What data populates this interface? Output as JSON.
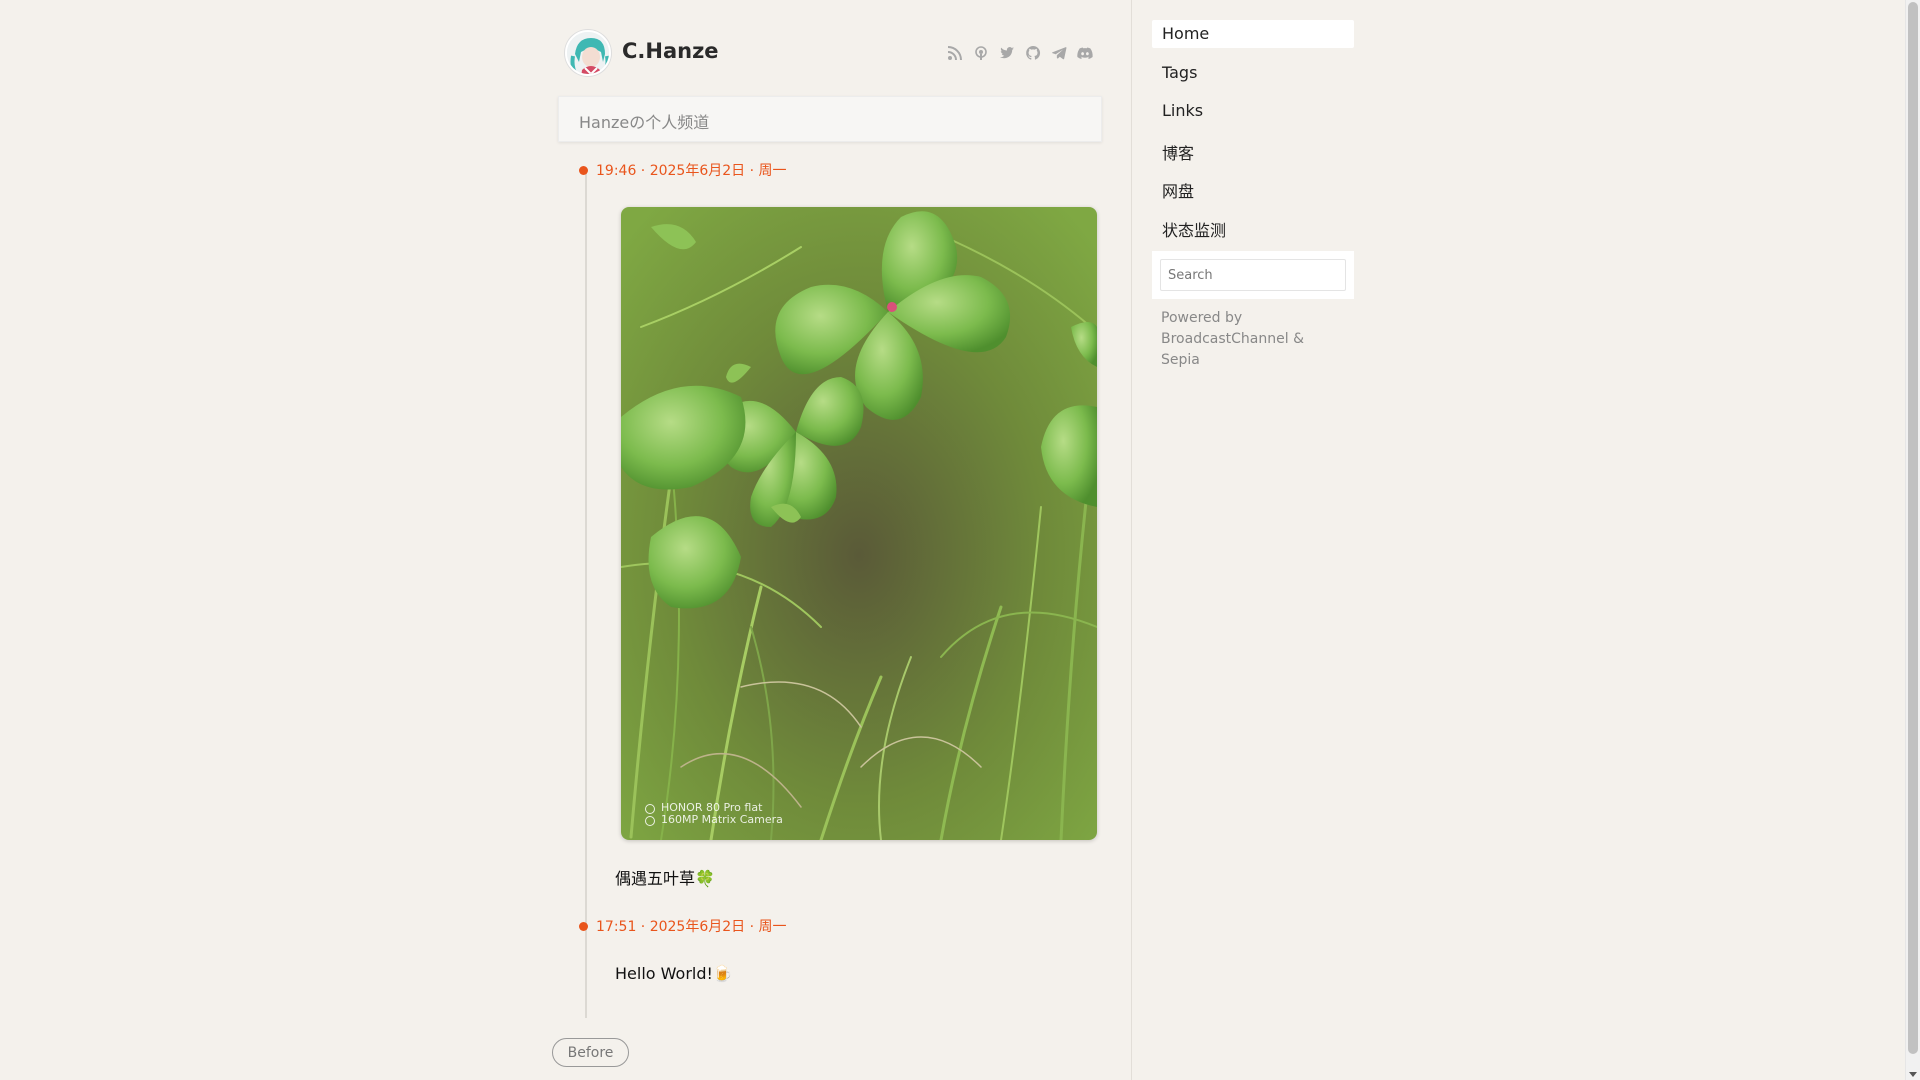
{
  "header": {
    "site_title": "C.Hanze",
    "avatar_alt": "C.Hanze avatar",
    "social_icons": [
      "rss-icon",
      "podcast-icon",
      "twitter-icon",
      "github-icon",
      "telegram-icon",
      "discord-icon"
    ]
  },
  "channel": {
    "description": "Hanzeの个人频道"
  },
  "posts": [
    {
      "time": "19:46 · 2025年6月2日 · 周一",
      "watermark_line1": "HONOR 80 Pro flat",
      "watermark_line2": "160MP Matrix Camera",
      "text": "偶遇五叶草🍀"
    },
    {
      "time": "17:51 · 2025年6月2日 · 周一",
      "text": "Hello World!🍺"
    }
  ],
  "pagination": {
    "before_label": "Before"
  },
  "sidebar": {
    "nav": [
      {
        "label": "Home"
      },
      {
        "label": "Tags"
      },
      {
        "label": "Links"
      },
      {
        "label": "博客"
      },
      {
        "label": "网盘"
      },
      {
        "label": "状态监测"
      }
    ],
    "search_placeholder": "Search",
    "powered_prefix": "Powered by",
    "powered_link1": "BroadcastChannel",
    "powered_amp": "&",
    "powered_link2": "Sepia"
  },
  "colors": {
    "accent": "#e9551c",
    "background": "#f4f1ec"
  }
}
